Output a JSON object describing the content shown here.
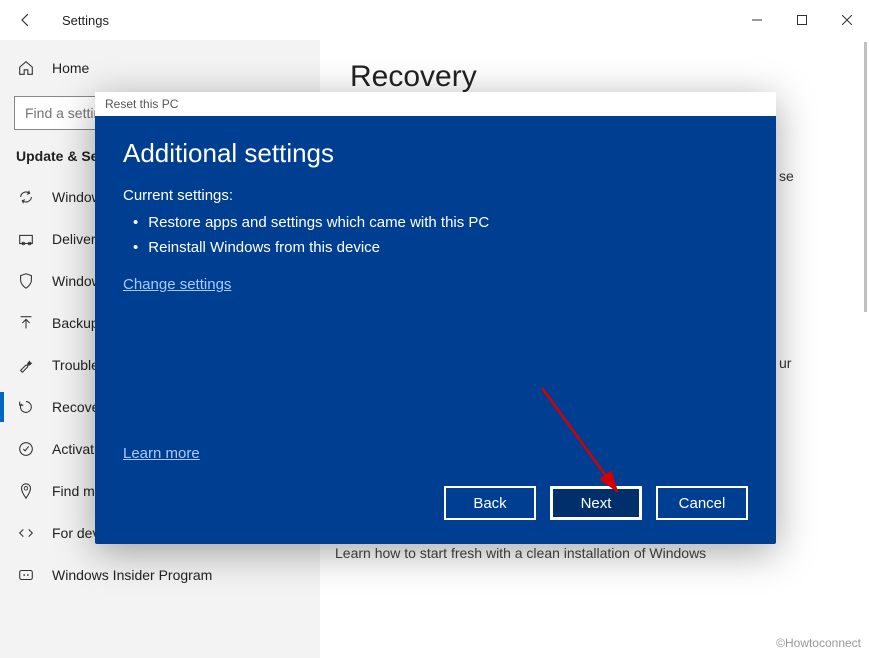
{
  "titlebar": {
    "title": "Settings"
  },
  "sidebar": {
    "home_label": "Home",
    "search_placeholder": "Find a setting",
    "section_heading": "Update & Security",
    "items": [
      {
        "label": "Windows Update"
      },
      {
        "label": "Delivery Optimization"
      },
      {
        "label": "Windows Security"
      },
      {
        "label": "Backup"
      },
      {
        "label": "Troubleshoot"
      },
      {
        "label": "Recovery"
      },
      {
        "label": "Activation"
      },
      {
        "label": "Find my device"
      },
      {
        "label": "For developers"
      },
      {
        "label": "Windows Insider Program"
      }
    ]
  },
  "content": {
    "page_title": "Recovery",
    "partial_text_1": "se",
    "partial_text_2": "ur",
    "start_fresh": "Learn how to start fresh with a clean installation of Windows"
  },
  "modal": {
    "window_title": "Reset this PC",
    "heading": "Additional settings",
    "current_settings_label": "Current settings:",
    "bullets": [
      "Restore apps and settings which came with this PC",
      "Reinstall Windows from this device"
    ],
    "change_settings": "Change settings",
    "learn_more": "Learn more",
    "buttons": {
      "back": "Back",
      "next": "Next",
      "cancel": "Cancel"
    }
  },
  "watermark": "©Howtoconnect"
}
